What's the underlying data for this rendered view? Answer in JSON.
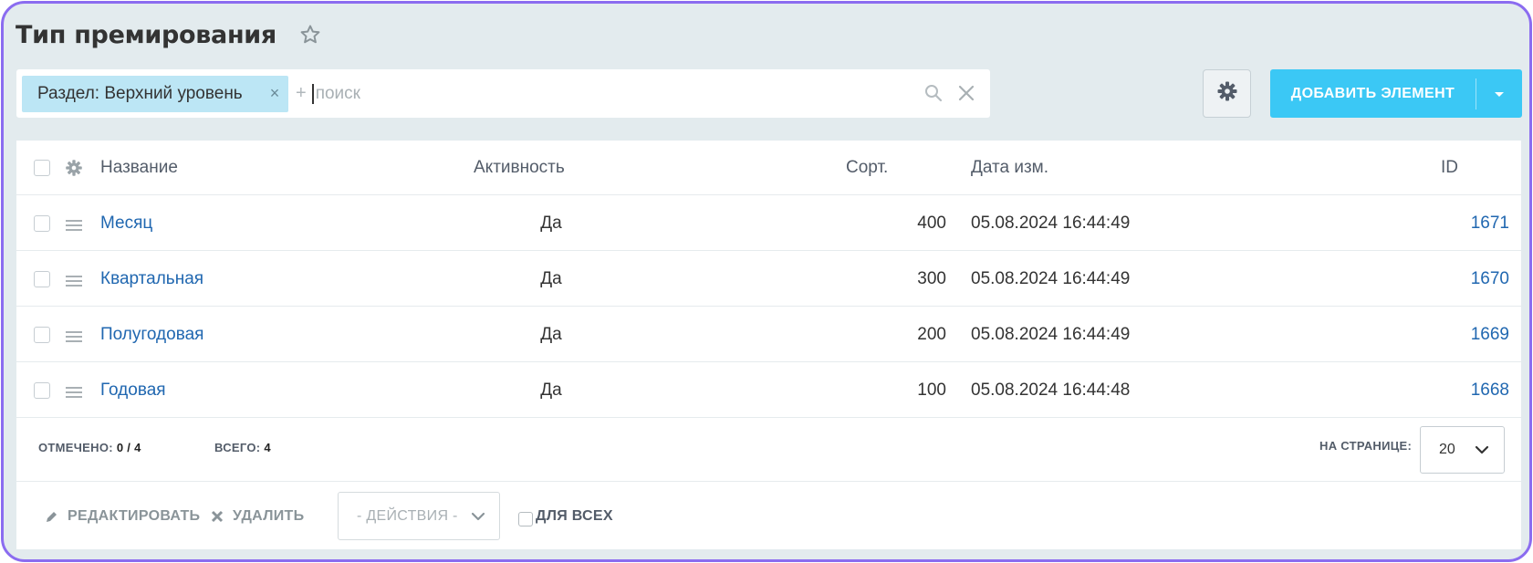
{
  "page": {
    "title": "Тип премирования"
  },
  "filter": {
    "chip_label": "Раздел: Верхний уровень",
    "chip_close": "×",
    "plus": "+",
    "search_placeholder": "поиск"
  },
  "toolbar": {
    "add_label": "ДОБАВИТЬ ЭЛЕМЕНТ"
  },
  "table": {
    "columns": {
      "name": "Название",
      "active": "Активность",
      "sort": "Сорт.",
      "date": "Дата изм.",
      "id": "ID"
    },
    "rows": [
      {
        "name": "Месяц",
        "active": "Да",
        "sort": "400",
        "date": "05.08.2024 16:44:49",
        "id": "1671"
      },
      {
        "name": "Квартальная",
        "active": "Да",
        "sort": "300",
        "date": "05.08.2024 16:44:49",
        "id": "1670"
      },
      {
        "name": "Полугодовая",
        "active": "Да",
        "sort": "200",
        "date": "05.08.2024 16:44:49",
        "id": "1669"
      },
      {
        "name": "Годовая",
        "active": "Да",
        "sort": "100",
        "date": "05.08.2024 16:44:48",
        "id": "1668"
      }
    ]
  },
  "footer": {
    "selected_label": "ОТМЕЧЕНО:",
    "selected_value": "0 / 4",
    "total_label": "ВСЕГО:",
    "total_value": "4",
    "per_page_label": "НА СТРАНИЦЕ:",
    "per_page_value": "20"
  },
  "actions": {
    "edit_label": "РЕДАКТИРОВАТЬ",
    "delete_label": "УДАЛИТЬ",
    "actions_select_value": "- ДЕЙСТВИЯ -",
    "for_all_label": "ДЛЯ ВСЕХ"
  },
  "colors": {
    "accent": "#3bc8f5",
    "link": "#2067b0",
    "chip": "#bce6f5",
    "frame": "#8b6cf0",
    "background": "#e3ebee"
  }
}
